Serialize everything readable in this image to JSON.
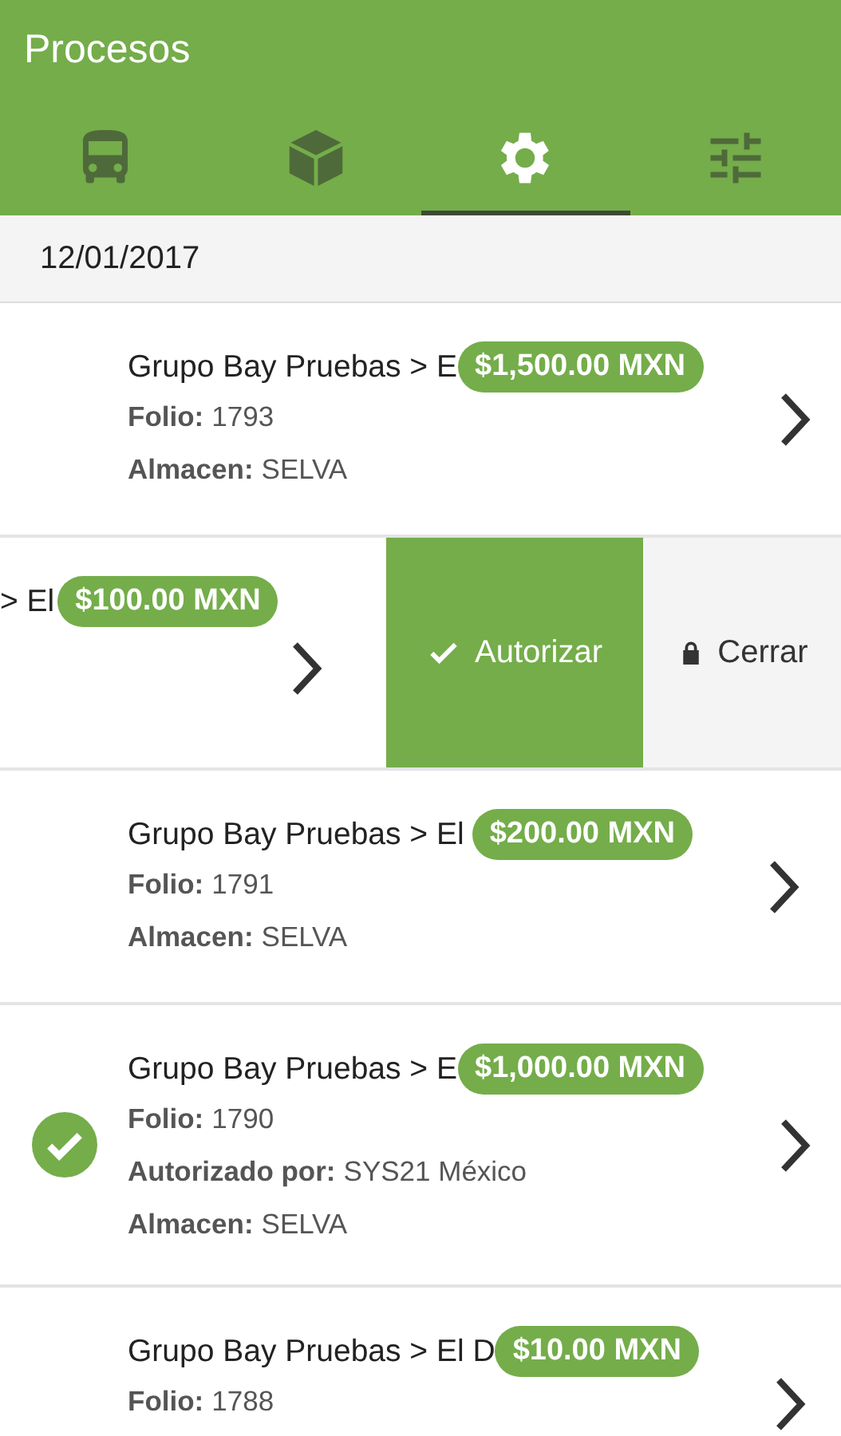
{
  "app_bar": {
    "title": "Procesos"
  },
  "tabs": [
    {
      "kind": "bus",
      "selected": false
    },
    {
      "kind": "box",
      "selected": false
    },
    {
      "kind": "gear",
      "selected": true
    },
    {
      "kind": "sliders",
      "selected": false
    }
  ],
  "date_header": "12/01/2017",
  "rows": [
    {
      "kind": "normal",
      "title": "Grupo Bay Pruebas > E",
      "amount": "$1,500.00 MXN",
      "authorized": false,
      "fields": [
        {
          "label": "Folio:",
          "value": "1793"
        },
        {
          "label": "Almacen:",
          "value": "SELVA"
        }
      ]
    },
    {
      "kind": "swiped",
      "title": "> El",
      "amount": "$100.00 MXN",
      "actions": [
        {
          "kind": "authorize",
          "label": "Autorizar"
        },
        {
          "kind": "close",
          "label": "Cerrar"
        }
      ]
    },
    {
      "kind": "normal",
      "title": "Grupo Bay Pruebas > El",
      "amount": "$200.00 MXN",
      "authorized": false,
      "fields": [
        {
          "label": "Folio:",
          "value": "1791"
        },
        {
          "label": "Almacen:",
          "value": "SELVA"
        }
      ]
    },
    {
      "kind": "normal",
      "title": "Grupo Bay Pruebas > E",
      "amount": "$1,000.00 MXN",
      "authorized": true,
      "fields": [
        {
          "label": "Folio:",
          "value": "1790"
        },
        {
          "label": "Autorizado por:",
          "value": "SYS21 México"
        },
        {
          "label": "Almacen:",
          "value": "SELVA"
        }
      ]
    },
    {
      "kind": "normal",
      "title": "Grupo Bay Pruebas > El D",
      "amount": "$10.00 MXN",
      "authorized": false,
      "fields": [
        {
          "label": "Folio:",
          "value": "1788"
        }
      ]
    }
  ]
}
